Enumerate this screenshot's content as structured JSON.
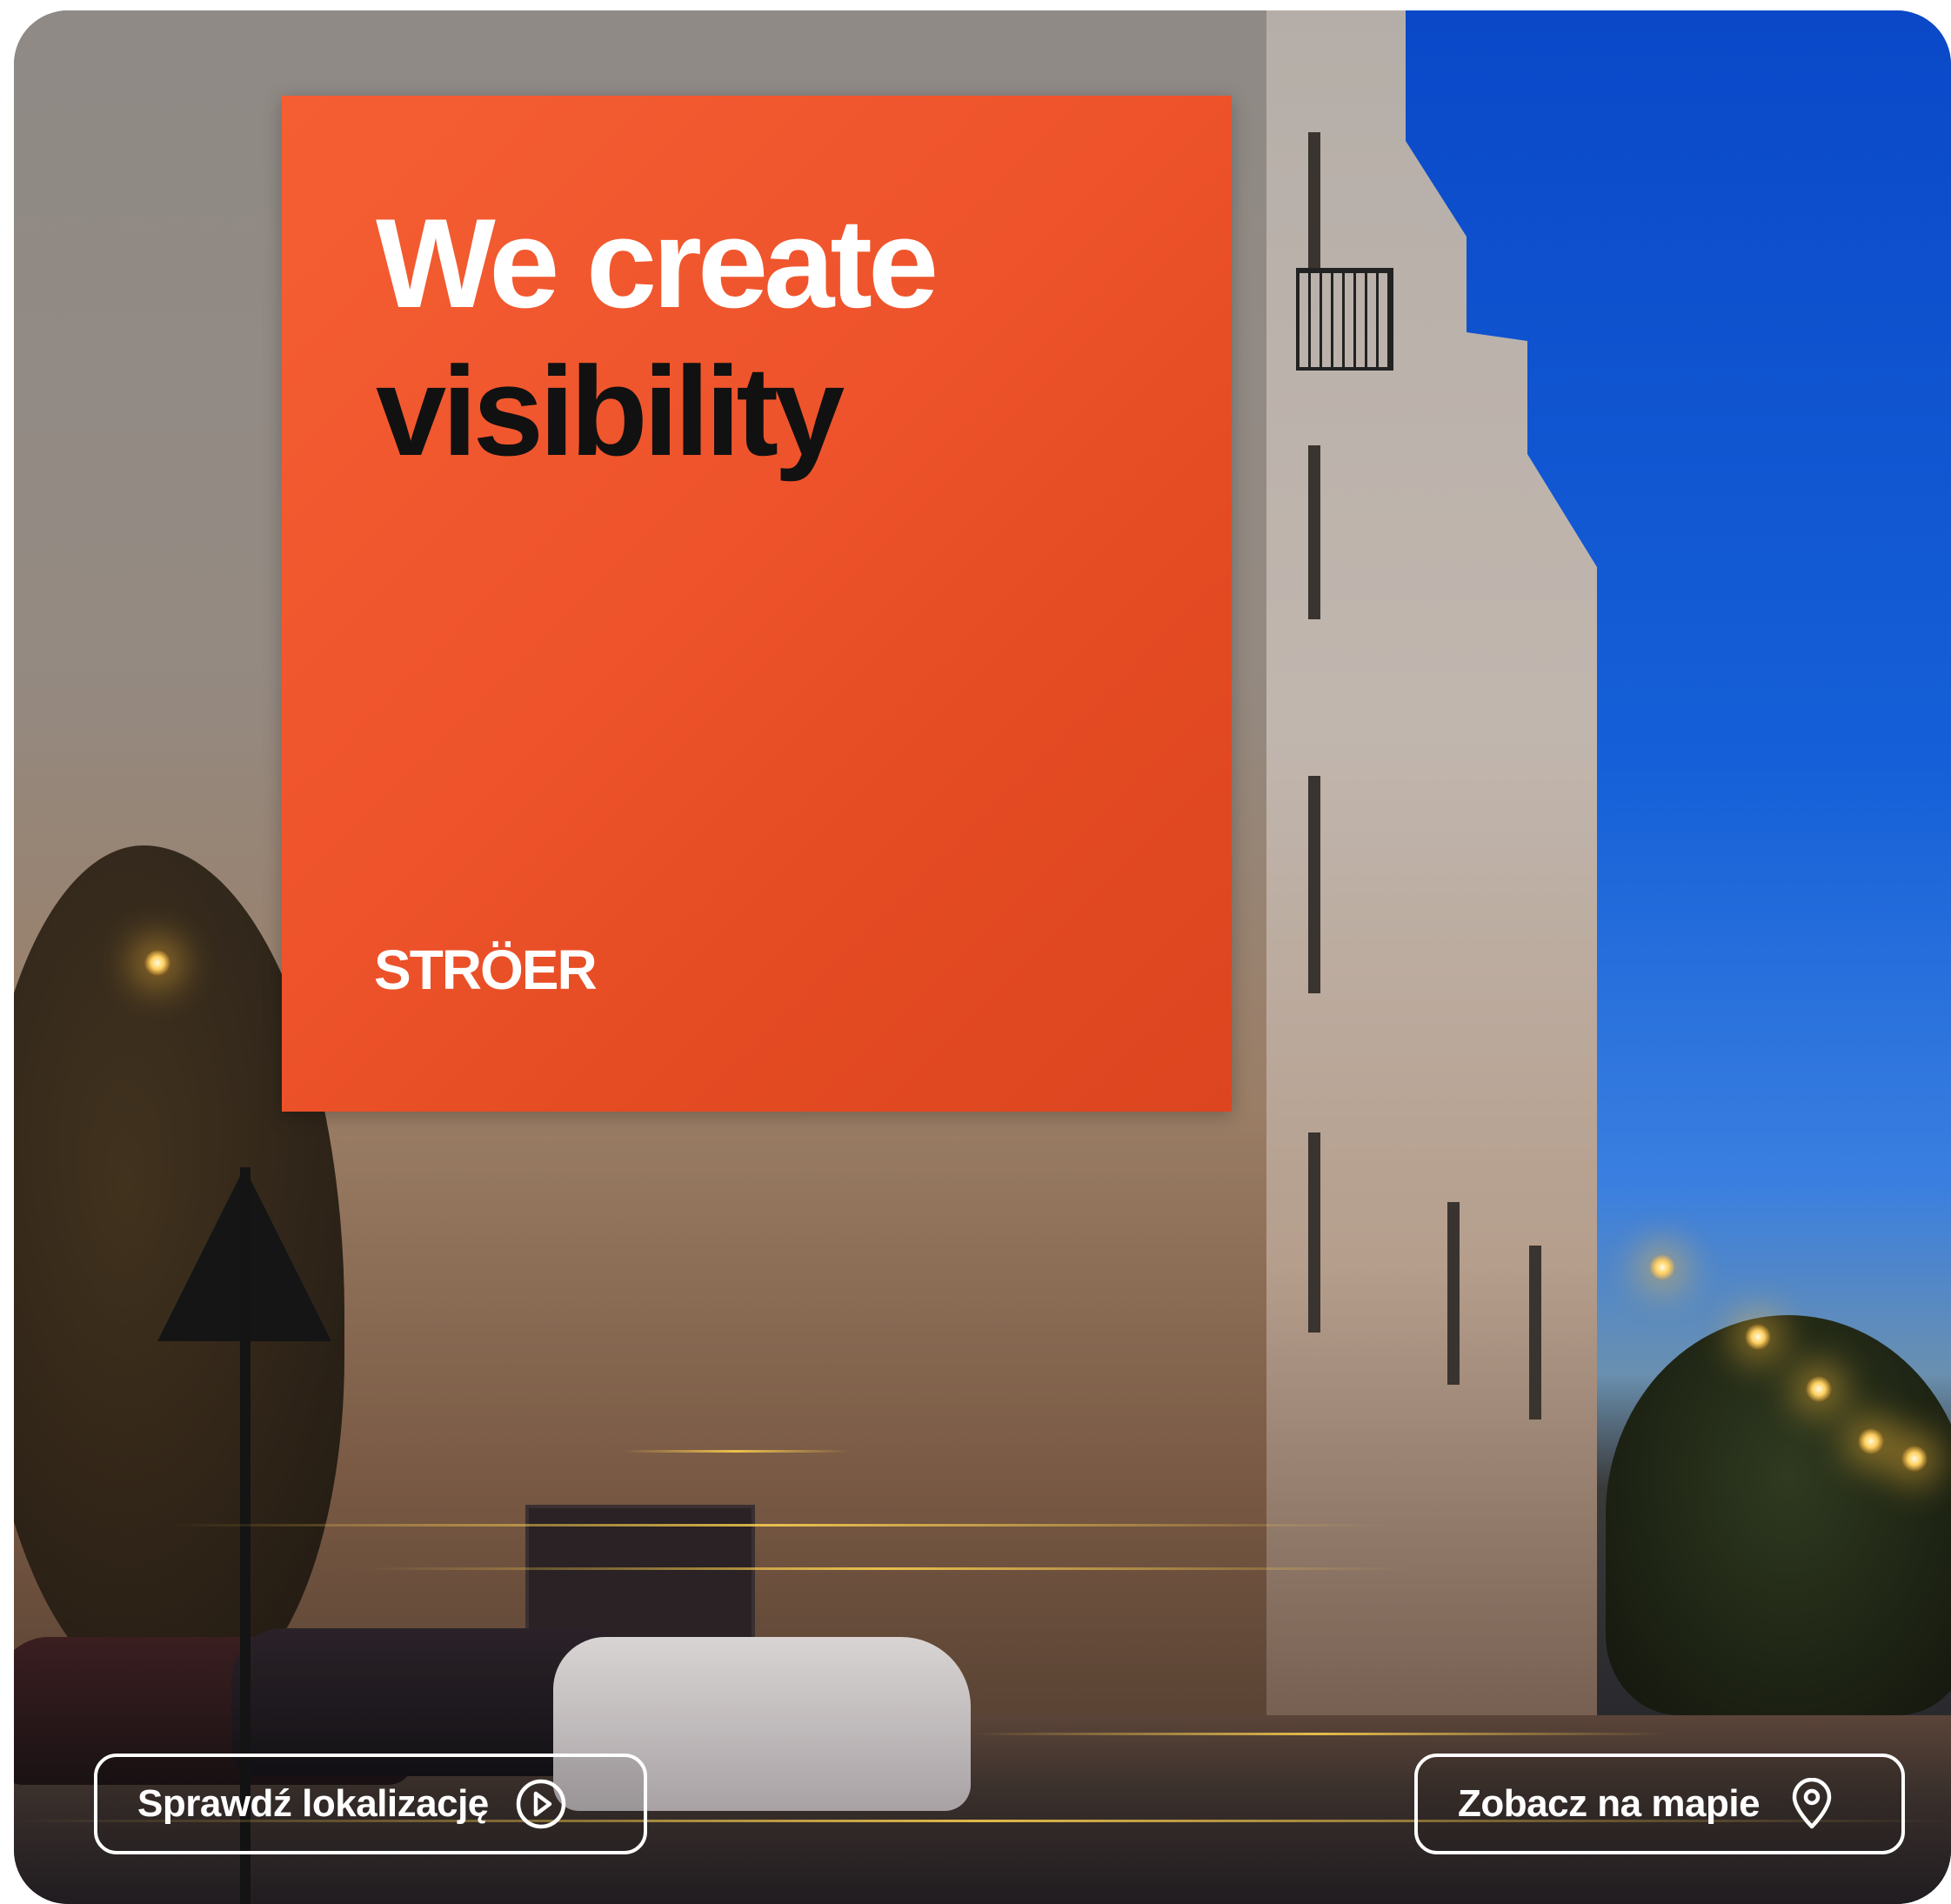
{
  "billboard": {
    "headline_line1": "We create",
    "headline_line2": "visibility",
    "logo_text": "STRÖER",
    "colors": {
      "background": "#ee532b",
      "headline_light": "#ffffff",
      "headline_dark": "#111111"
    }
  },
  "actions": {
    "check_location": {
      "label": "Sprawdź lokalizację",
      "icon": "play-circle-icon"
    },
    "view_on_map": {
      "label": "Zobacz na mapie",
      "icon": "map-pin-icon"
    }
  }
}
